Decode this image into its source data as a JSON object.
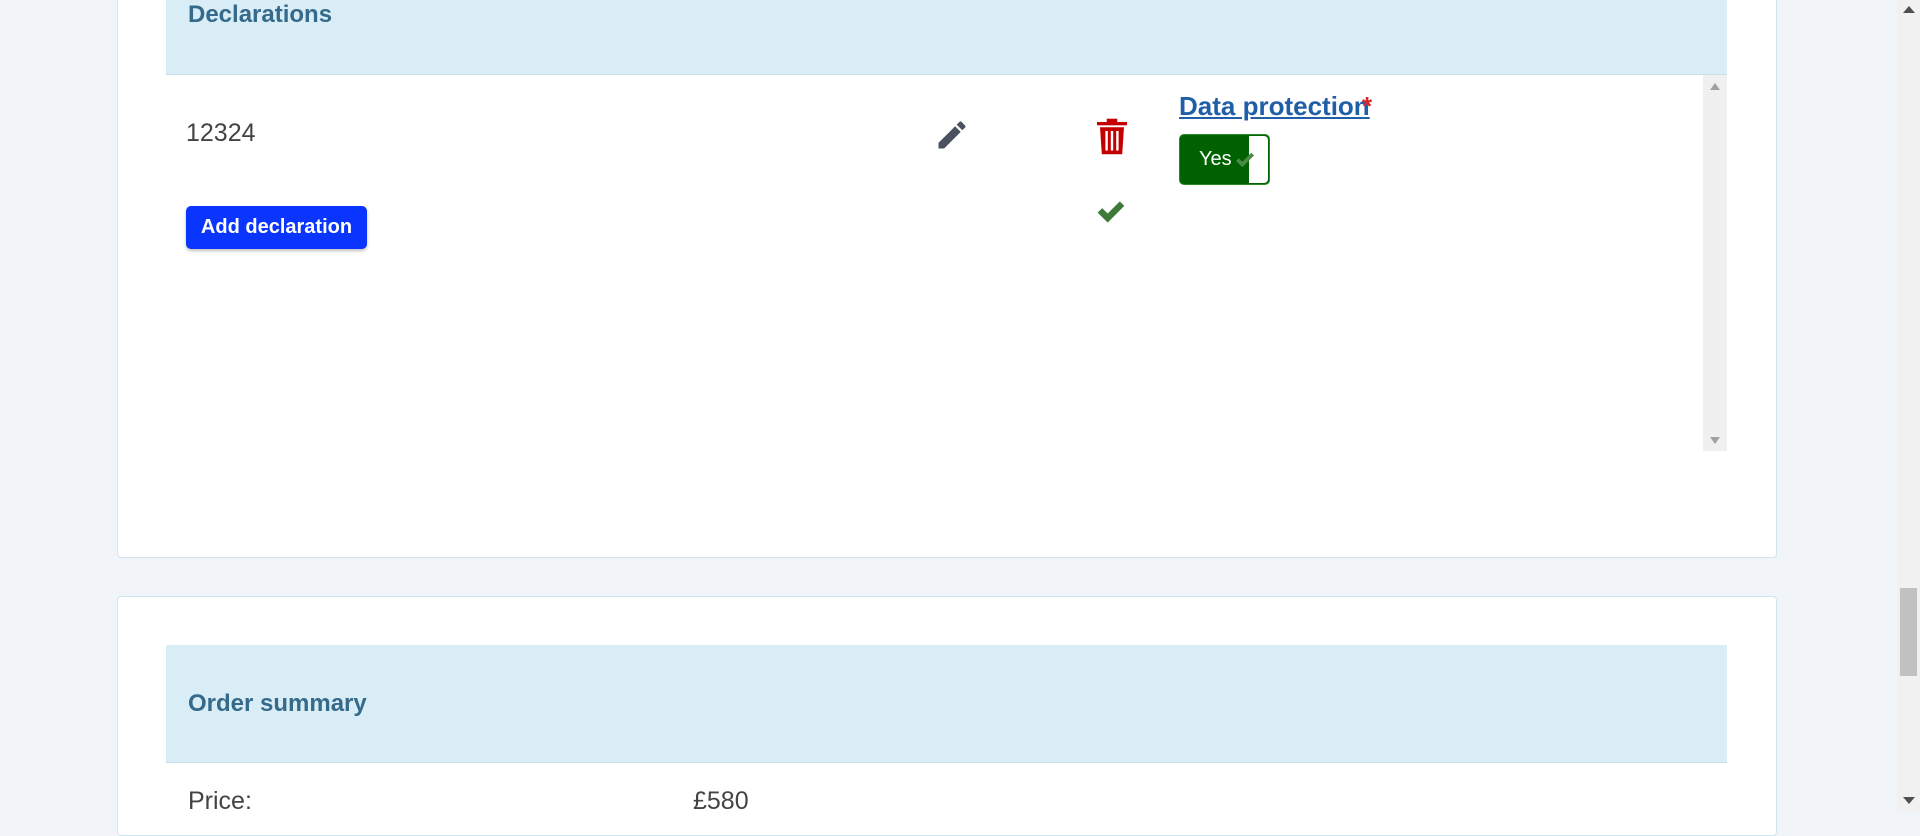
{
  "declarations": {
    "title": "Declarations",
    "entry_value": "12324",
    "add_button_label": "Add declaration",
    "data_protection": {
      "label": "Data protection",
      "required_marker": "*",
      "toggle_label": "Yes"
    }
  },
  "order_summary": {
    "title": "Order summary",
    "price_label": "Price:",
    "price_value": "£580"
  },
  "colors": {
    "accent_blue": "#0a35ff",
    "toggle_green": "#006100",
    "check_green": "#3f7a3a",
    "delete_red": "#c40000",
    "section_header_bg": "#d9edf6"
  },
  "icons": [
    "pencil-icon",
    "trash-icon",
    "check-icon"
  ]
}
